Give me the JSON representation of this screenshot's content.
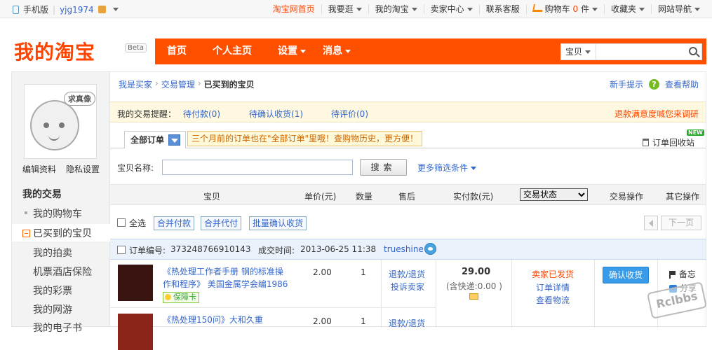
{
  "topbar": {
    "mobile": "手机版",
    "username": "yjg1974",
    "links": [
      "淘宝网首页",
      "我要逛",
      "我的淘宝",
      "卖家中心",
      "联系客服",
      "购物车",
      "收藏夹",
      "网站导航"
    ],
    "cart_count": "0",
    "cart_unit": "件"
  },
  "header": {
    "logo": "我的淘宝",
    "beta": "Beta",
    "nav": [
      "首页",
      "个人主页",
      "设置",
      "消息"
    ],
    "search_select": "宝贝"
  },
  "sidebar": {
    "avatar_bubble": "求真像",
    "edit_profile": "编辑资料",
    "privacy": "隐私设置",
    "section_title": "我的交易",
    "items": [
      "我的购物车",
      "已买到的宝贝",
      "我的拍卖",
      "机票酒店保险",
      "我的彩票",
      "我的网游",
      "我的电子书"
    ]
  },
  "breadcrumb": [
    "我是买家",
    "交易管理",
    "已买到的宝贝"
  ],
  "help": {
    "newbie": "新手提示",
    "view_help": "查看帮助",
    "q": "?"
  },
  "remind": {
    "label": "我的交易提醒：",
    "pending_pay": "待付款(0)",
    "pending_confirm": "待确认收货(1)",
    "pending_review": "待评价(0)",
    "survey": "退款满意度喊您来调研"
  },
  "tabs": {
    "all_orders": "全部订单",
    "tip": "三个月前的订单也在\"全部订单\"里哦！查购物历史，更方便！",
    "recycle": "订单回收站",
    "new_badge": "NEW"
  },
  "filter": {
    "label": "宝贝名称:",
    "search_btn": "搜索",
    "more": "更多筛选条件"
  },
  "table_header": {
    "item": "宝贝",
    "unit_price": "单价(元)",
    "qty": "数量",
    "after_sale": "售后",
    "paid": "实付款(元)",
    "status_select": "交易状态",
    "op": "交易操作",
    "other": "其它操作"
  },
  "bulk": {
    "select_all": "全选",
    "merge_pay": "合并付款",
    "merge_proxy": "合并代付",
    "batch_confirm": "批量确认收货",
    "next_page": "下一页"
  },
  "order": {
    "no_label": "订单编号:",
    "no": "373248766910143",
    "time_label": "成交时间:",
    "time": "2013-06-25 11:38",
    "seller": "trueshine",
    "items": [
      {
        "title_line1": "《热处理工作者手册 钢的标准操",
        "title_line2": "作和程序》 美国金属学会编1986",
        "badge": "保障卡",
        "price": "2.00",
        "qty": "1",
        "after_sale_1": "退款/退货",
        "after_sale_2": "投诉卖家"
      },
      {
        "title_line1": "《热处理150问》大和久重",
        "price": "2.00",
        "qty": "1",
        "after_sale_1": "退款/退货"
      }
    ],
    "total": "29.00",
    "shipping": "(含快递:0.00 )",
    "status": "卖家已发货",
    "detail": "订单详情",
    "logistics": "查看物流",
    "confirm": "确认收货",
    "memo": "备忘",
    "share": "分享"
  },
  "watermark": "Rclbbs"
}
